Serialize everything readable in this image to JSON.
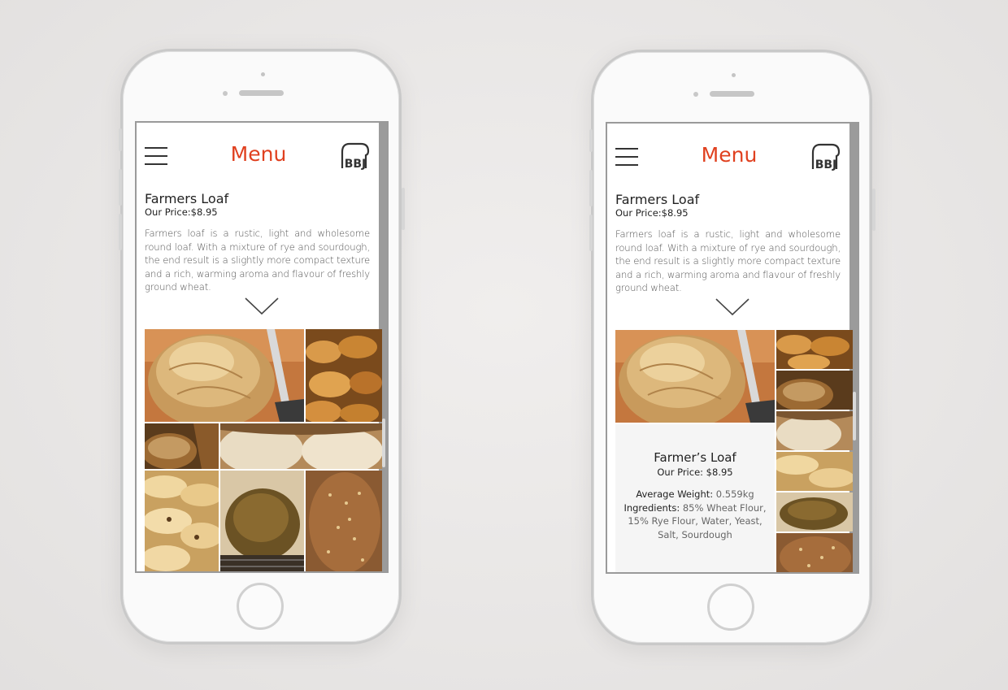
{
  "screens": [
    {
      "id": "left",
      "header": {
        "title": "Menu",
        "logo_text": "BBJ"
      },
      "product": {
        "name": "Farmers Loaf",
        "price_line": "Our Price:$8.95",
        "description": "Farmers loaf is a rustic, light and wholesome round loaf. With a mixture of rye and sourdough, the end result is a slightly more compact texture and a rich, warming aroma and flavour of freshly ground wheat."
      }
    },
    {
      "id": "right",
      "header": {
        "title": "Menu",
        "logo_text": "BBJ"
      },
      "product": {
        "name": "Farmers Loaf",
        "price_line": "Our Price:$8.95",
        "description": "Farmers loaf is a rustic, light and wholesome round loaf. With a mixture of rye and sourdough, the end result is a slightly more compact texture and a rich, warming aroma and flavour of freshly ground wheat."
      },
      "detail_card": {
        "name": "Farmer’s Loaf",
        "price_line": "Our Price: $8.95",
        "weight_label": "Average Weight:",
        "weight_value": "0.559kg",
        "ingredients_label": "Ingredients:",
        "ingredients_value": "85% Wheat Flour, 15% Rye Flour, Water, Yeast, Salt, Sourdough"
      }
    }
  ],
  "colors": {
    "accent": "#e0401f",
    "text": "#222222",
    "muted_text": "#555555",
    "screen_border": "#9a9a9a",
    "phone_body": "#fafafa"
  },
  "icons": [
    "hamburger-menu-icon",
    "bbj-logo-icon",
    "chevron-down-icon"
  ]
}
